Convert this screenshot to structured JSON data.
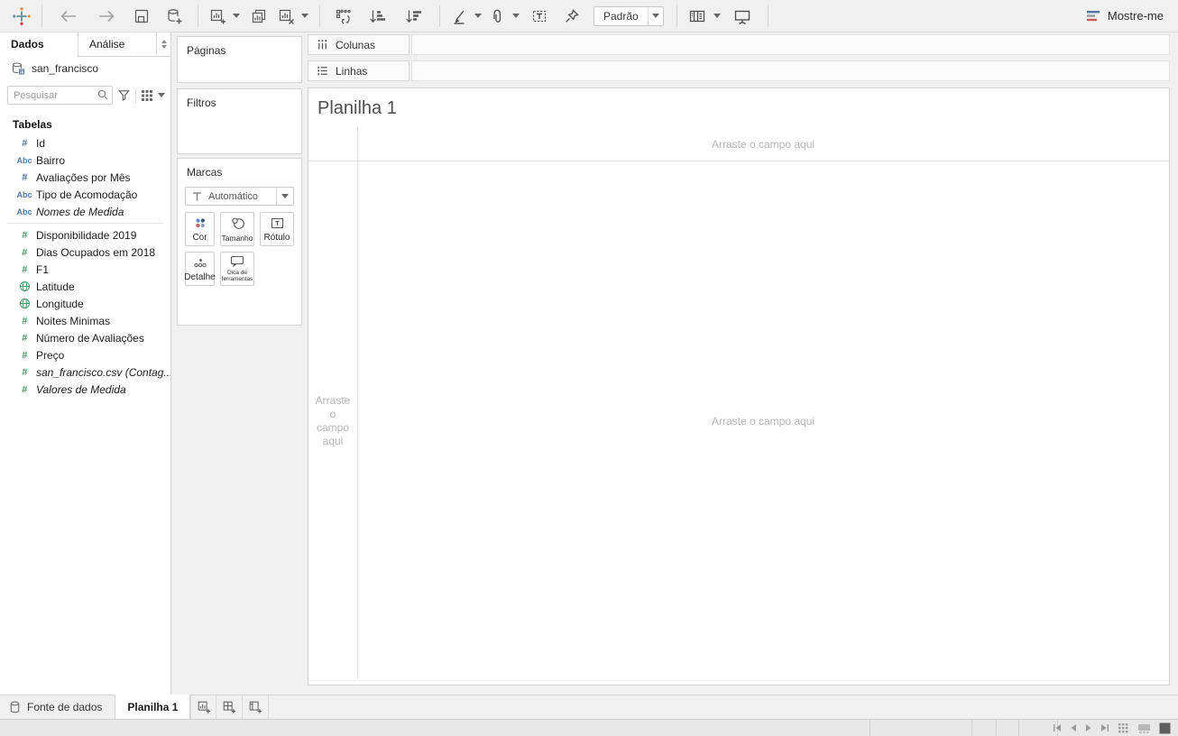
{
  "toolbar": {
    "fit_value": "Padrão",
    "show_me_label": "Mostre-me",
    "icons": [
      "tableau-logo",
      "undo",
      "redo",
      "save",
      "new-data-source",
      "new-worksheet",
      "duplicate-sheet",
      "clear-sheet",
      "swap-rows-columns",
      "sort-ascending",
      "sort-descending",
      "highlight",
      "group-members",
      "show-mark-labels",
      "fix-axes",
      "fit-selector",
      "show-hide-cards",
      "presentation-mode",
      "show-me"
    ]
  },
  "sidebar": {
    "tabs": {
      "data": "Dados",
      "analytics": "Análise"
    },
    "connection": "san_francisco",
    "search_placeholder": "Pesquisar",
    "section_title": "Tabelas",
    "icon_glyphs": {
      "number": "#",
      "text": "Abc"
    },
    "fields": [
      {
        "label": "Id",
        "icon": "number",
        "role": "dimension",
        "italic": false
      },
      {
        "label": "Bairro",
        "icon": "text",
        "role": "dimension",
        "italic": false
      },
      {
        "label": "Avaliações por Mês",
        "icon": "number",
        "role": "dimension",
        "italic": false
      },
      {
        "label": "Tipo de Acomodação",
        "icon": "text",
        "role": "dimension",
        "italic": false
      },
      {
        "label": "Nomes de Medida",
        "icon": "text",
        "role": "dimension",
        "italic": true
      },
      {
        "label": "Disponibilidade 2019",
        "icon": "number",
        "role": "measure",
        "italic": false
      },
      {
        "label": "Dias Ocupados em 2018",
        "icon": "number",
        "role": "measure",
        "italic": false
      },
      {
        "label": "F1",
        "icon": "number",
        "role": "measure",
        "italic": false
      },
      {
        "label": "Latitude",
        "icon": "globe",
        "role": "measure",
        "italic": false
      },
      {
        "label": "Longitude",
        "icon": "globe",
        "role": "measure",
        "italic": false
      },
      {
        "label": "Noites Minimas",
        "icon": "number",
        "role": "measure",
        "italic": false
      },
      {
        "label": "Número de Avaliações",
        "icon": "number",
        "role": "measure",
        "italic": false
      },
      {
        "label": "Preço",
        "icon": "number",
        "role": "measure",
        "italic": false
      },
      {
        "label": "san_francisco.csv (Contag...",
        "icon": "number",
        "role": "measure",
        "italic": true
      },
      {
        "label": "Valores de Medida",
        "icon": "number",
        "role": "measure",
        "italic": true
      }
    ]
  },
  "cards": {
    "pages_title": "Páginas",
    "filters_title": "Filtros",
    "marks": {
      "title": "Marcas",
      "mark_type": "Automático",
      "buttons": [
        "Cor",
        "Tamanho",
        "Rótulo",
        "Detalhe",
        "Dica de ferramentas"
      ]
    }
  },
  "shelves": {
    "columns_label": "Colunas",
    "rows_label": "Linhas"
  },
  "canvas": {
    "sheet_title": "Planilha 1",
    "drop_hint": "Arraste o campo aqui"
  },
  "bottom": {
    "datasource_tab": "Fonte de dados",
    "sheet_tab": "Planilha 1"
  },
  "colors": {
    "dimension": "#4f7aa7",
    "measure": "#4a9c6d",
    "logo_orange": "#e8762d",
    "logo_red": "#c72035",
    "logo_blue": "#59879b"
  }
}
